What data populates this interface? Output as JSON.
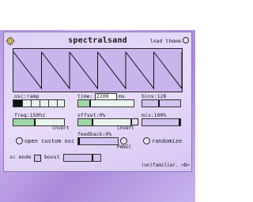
{
  "app": {
    "title": "spectralsand",
    "load_theme": "load theme",
    "credit": "(un)familiar. <B>"
  },
  "waveform": {
    "shape": "sawtooth",
    "cycles": 6
  },
  "osc": {
    "label": "osc:ramp",
    "segments": 6,
    "selected_index": 0
  },
  "time": {
    "label": "time:",
    "value": "2200",
    "unit": "ms",
    "slider_fraction": 0.2
  },
  "bins": {
    "label": "bins:128",
    "slider_fraction": 0.42
  },
  "freq": {
    "label": "freq:150hz",
    "slider_fraction": 0.4,
    "invert_label": "invert"
  },
  "offset": {
    "label": "offset:0%",
    "slider_fraction": 0.25,
    "invert_label": "invert"
  },
  "mix": {
    "label": "mix:100%",
    "slider_fraction": 1.0
  },
  "feedback": {
    "label": "feedback:0%",
    "slider_fraction": 0.0,
    "panic_label": "PANIC"
  },
  "buttons": {
    "open_custom_osc": "open custom osc",
    "randomize": "randomize"
  },
  "footer": {
    "sc_mode": "sc mode",
    "boost": "boost"
  },
  "colors": {
    "frame": "#b79bdf",
    "panel": "#e2d7f7",
    "slider_green": "#9fd8a8",
    "slider_purple": "#d2c3f0"
  }
}
